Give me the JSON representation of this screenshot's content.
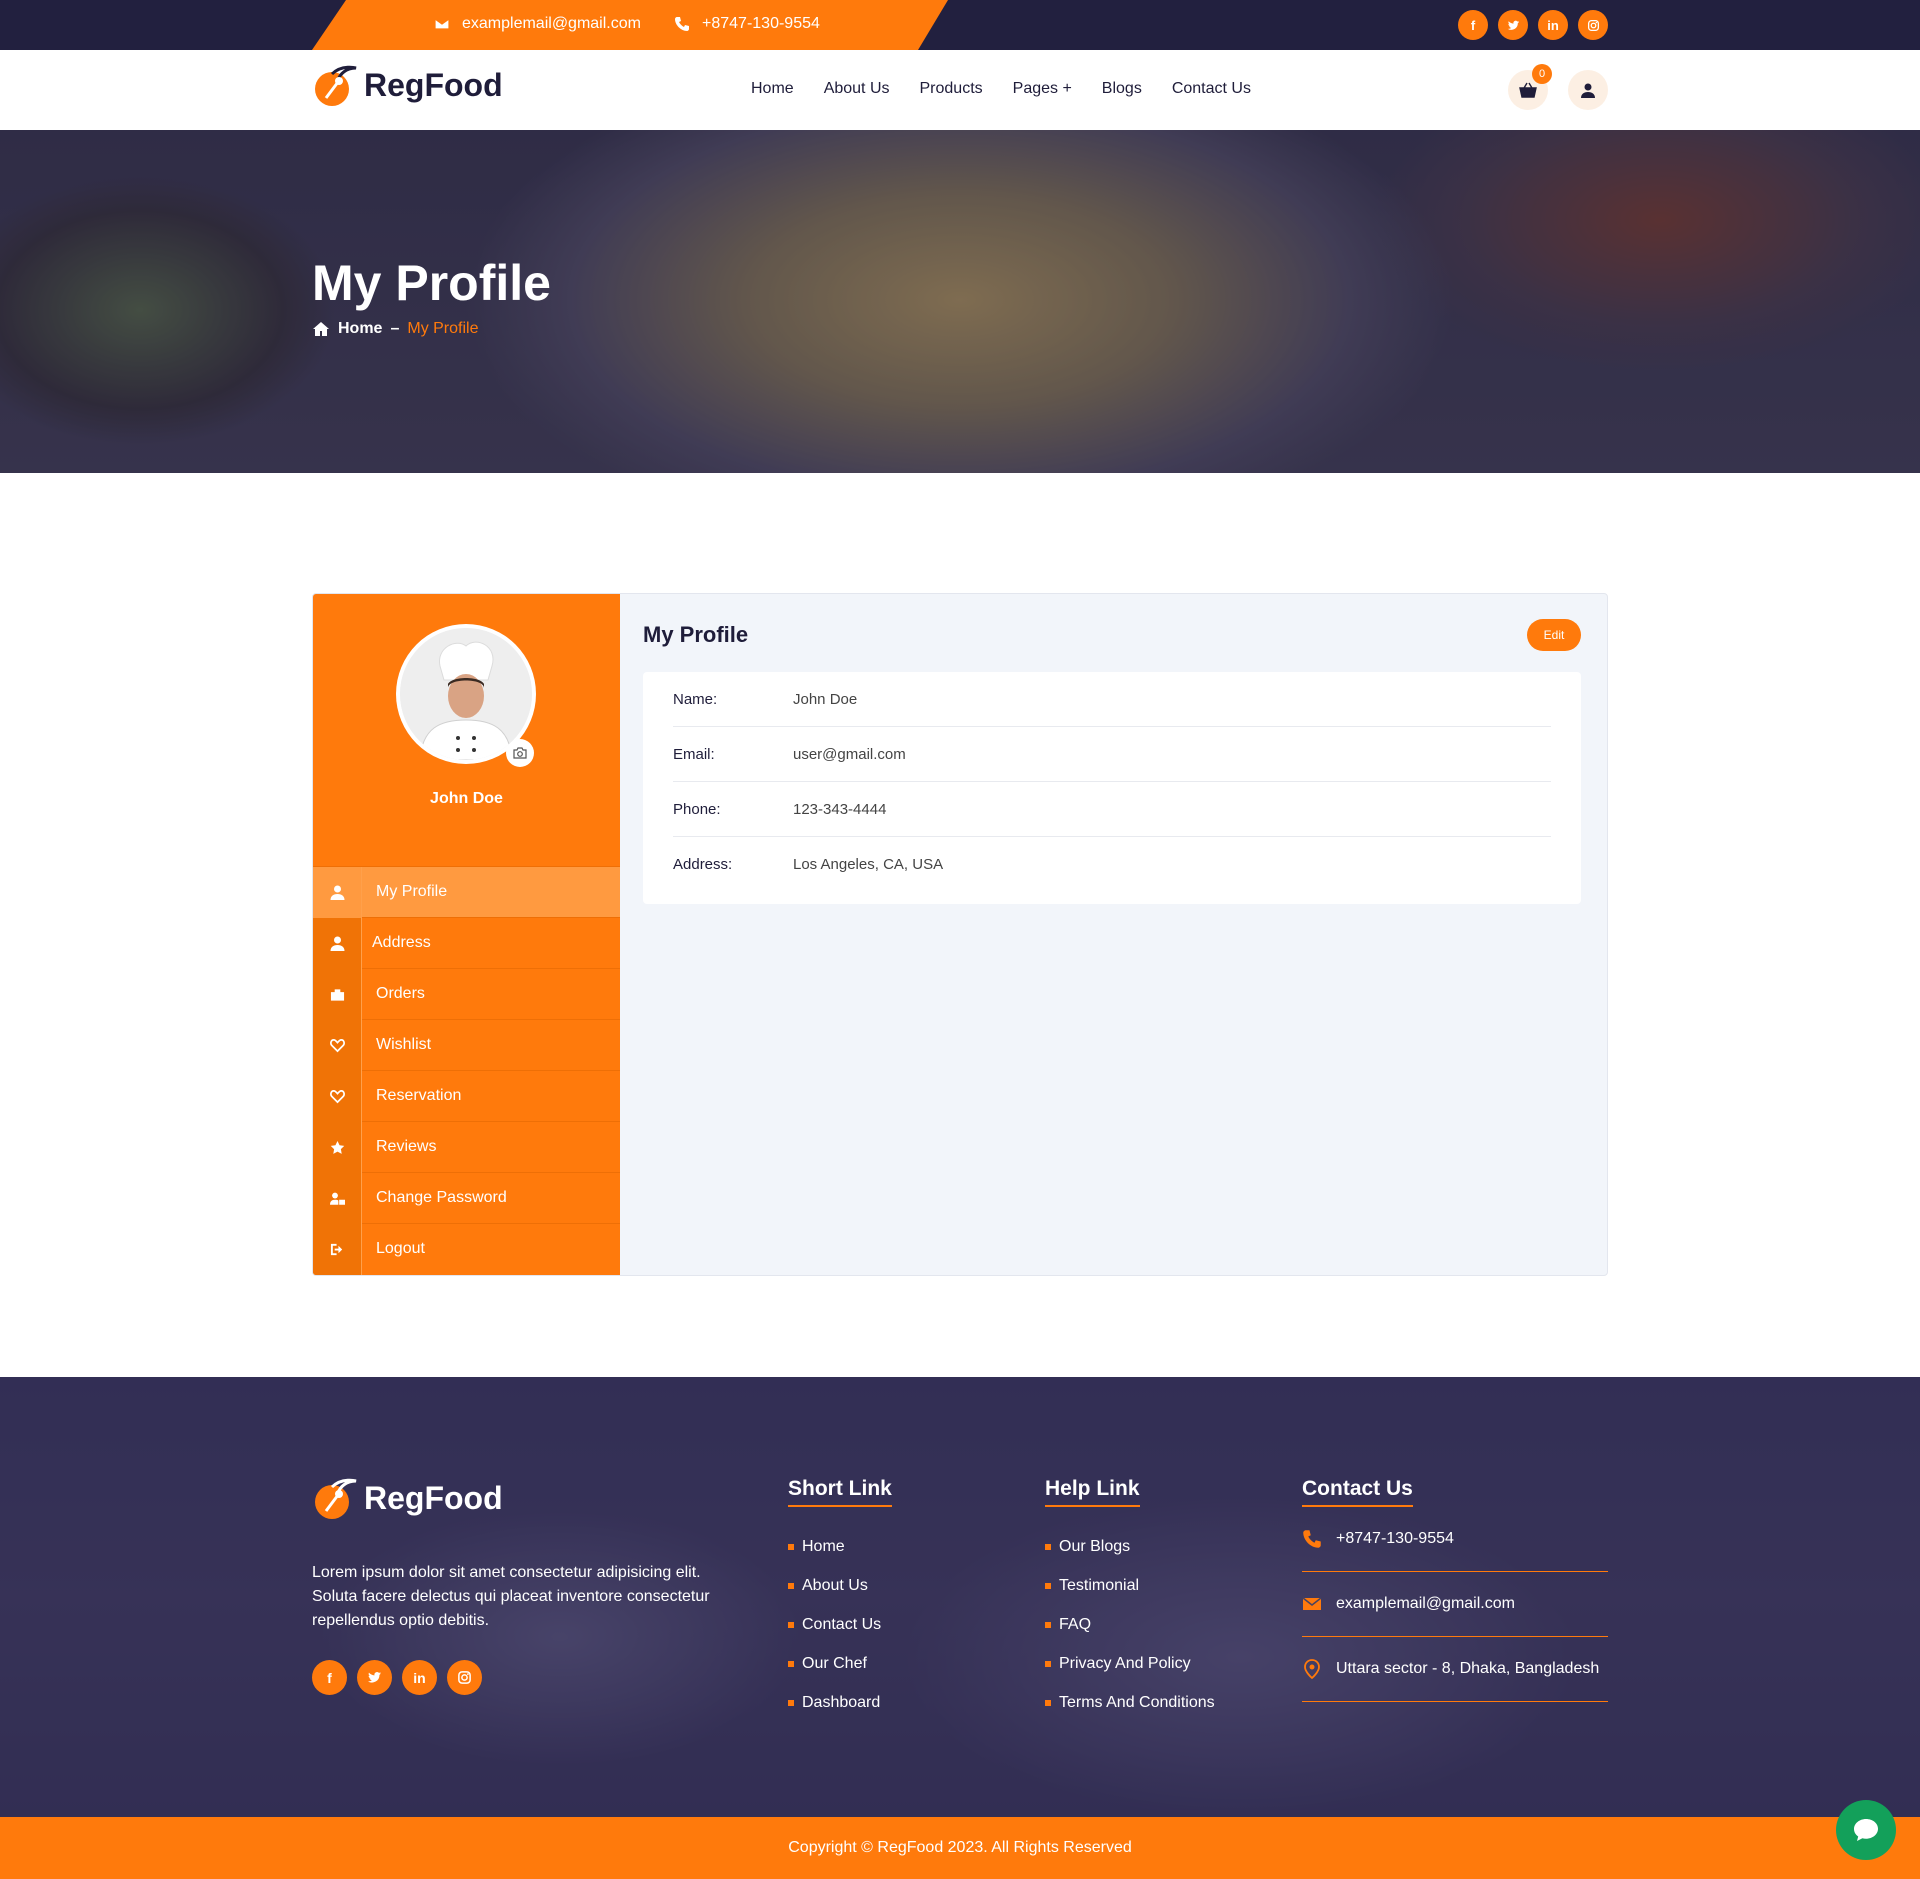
{
  "topbar": {
    "email": "examplemail@gmail.com",
    "phone": "+8747-130-9554",
    "socials": [
      "f",
      "t",
      "in",
      "ig"
    ]
  },
  "brand": {
    "name": "RegFood"
  },
  "nav": {
    "links": [
      "Home",
      "About Us",
      "Products",
      "Pages +",
      "Blogs",
      "Contact Us"
    ],
    "cart_count": "0"
  },
  "hero": {
    "title": "My Profile",
    "breadcrumb_home": "Home",
    "breadcrumb_sep": "–",
    "breadcrumb_current": "My Profile"
  },
  "sidebar": {
    "name": "John Doe",
    "menu": [
      {
        "label": "My Profile",
        "icon": "user-icon"
      },
      {
        "label": "Address",
        "icon": "user-icon"
      },
      {
        "label": "Orders",
        "icon": "bag-icon"
      },
      {
        "label": "Wishlist",
        "icon": "heart-icon"
      },
      {
        "label": "Reservation",
        "icon": "heart-icon"
      },
      {
        "label": "Reviews",
        "icon": "star-icon"
      },
      {
        "label": "Change Password",
        "icon": "user-lock-icon"
      },
      {
        "label": "Logout",
        "icon": "logout-icon"
      }
    ]
  },
  "profile": {
    "title": "My Profile",
    "edit_label": "Edit",
    "fields": [
      {
        "label": "Name:",
        "value": "John Doe"
      },
      {
        "label": "Email:",
        "value": "user@gmail.com"
      },
      {
        "label": "Phone:",
        "value": "123-343-4444"
      },
      {
        "label": "Address:",
        "value": "Los Angeles, CA, USA"
      }
    ]
  },
  "footer": {
    "description": "Lorem ipsum dolor sit amet consectetur adipisicing elit. Soluta facere delectus qui placeat inventore consectetur repellendus optio debitis.",
    "short_link_title": "Short Link",
    "short_links": [
      "Home",
      "About Us",
      "Contact Us",
      "Our Chef",
      "Dashboard"
    ],
    "help_link_title": "Help Link",
    "help_links": [
      "Our Blogs",
      "Testimonial",
      "FAQ",
      "Privacy And Policy",
      "Terms And Conditions"
    ],
    "contact_title": "Contact Us",
    "contact_phone": "+8747-130-9554",
    "contact_email": "examplemail@gmail.com",
    "contact_address": "Uttara sector - 8, Dhaka, Bangladesh",
    "copyright": "Copyright © RegFood 2023. All Rights Reserved"
  },
  "colors": {
    "accent": "#ff7a0c",
    "dark": "#22203f",
    "chat": "#13a05a"
  }
}
